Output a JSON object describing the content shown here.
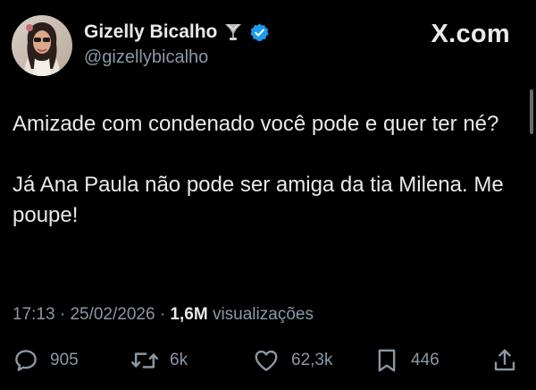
{
  "author": {
    "display_name": "Gizelly Bicalho",
    "handle": "@gizellybicalho",
    "avatar_icon": "profile-photo",
    "badges": [
      "trophy-icon",
      "verified-icon"
    ],
    "verified_color": "#1d9bf0"
  },
  "brand": {
    "label": "X.com"
  },
  "tweet": {
    "paragraphs": [
      "Amizade com condenado você pode e quer ter né?",
      "Já Ana Paula não pode ser amiga da tia Milena. Me poupe!"
    ],
    "time": "17:13",
    "separator": "·",
    "date": "25/02/2026",
    "views_count": "1,6M",
    "views_label": "visualizações"
  },
  "actions": {
    "replies": "905",
    "retweets": "6k",
    "likes": "62,3k",
    "bookmarks": "446"
  },
  "colors": {
    "background": "#000000",
    "text": "#e7e9ea",
    "muted": "#8b98a5"
  }
}
